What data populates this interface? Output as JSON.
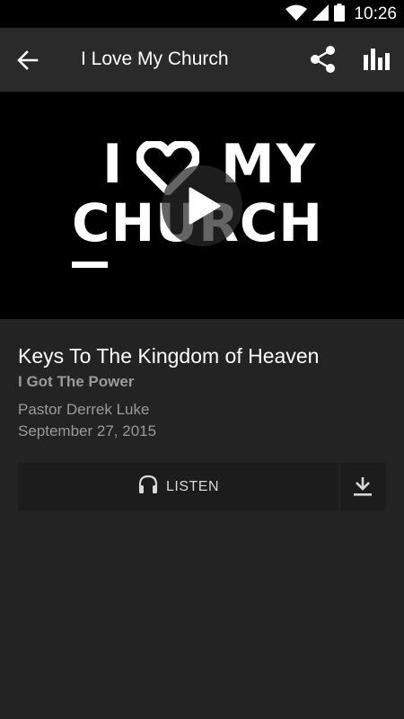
{
  "status_bar": {
    "time": "10:26",
    "icons": [
      "wifi-icon",
      "signal-icon",
      "battery-icon"
    ]
  },
  "app_bar": {
    "title": "I Love My Church",
    "back_icon": "arrow-left-icon",
    "share_icon": "share-icon",
    "stats_icon": "bar-chart-icon"
  },
  "hero": {
    "artwork_line1_left": "I",
    "artwork_line1_right": "MY",
    "artwork_line2": "CHURCH",
    "play_icon": "play-icon"
  },
  "sermon": {
    "title": "Keys To The Kingdom of Heaven",
    "series": "I Got The Power",
    "speaker": "Pastor Derrek Luke",
    "date": "September 27, 2015"
  },
  "actions": {
    "listen_label": "LISTEN",
    "listen_icon": "headphones-icon",
    "download_icon": "download-icon"
  },
  "colors": {
    "background": "#232323",
    "app_bar": "#2a2a2a",
    "button_bg": "#1c1c1c",
    "muted_text": "#9a9a9a"
  }
}
